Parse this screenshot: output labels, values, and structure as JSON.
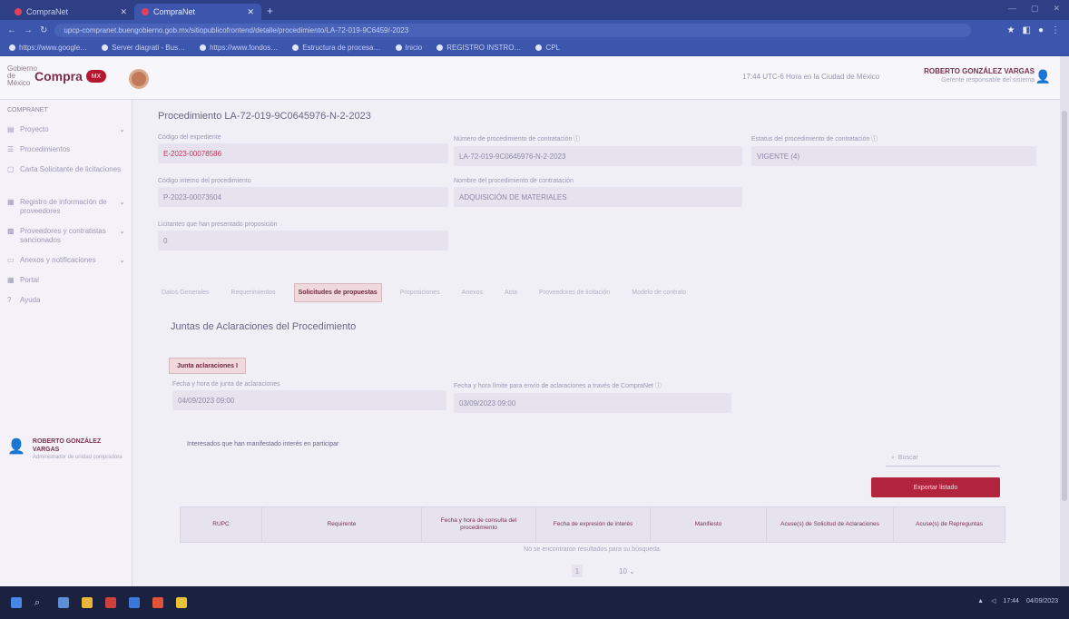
{
  "browser": {
    "tabs": [
      "CompraNet",
      "CompraNet"
    ],
    "url": "upcp-compranet.buengobierno.gob.mx/sitiopublicofrontend/detalle/procedimiento/LA-72-019-9C6459/-2023",
    "bookmarks": [
      "https://www.google…",
      "Server diagrati - Bus…",
      "https://www.fondos…",
      "Estructura de procesa…",
      "Inicio",
      "REGISTRO INSTRO…",
      "CPL"
    ]
  },
  "header": {
    "logo_gob": "Gobierno de México",
    "logo_name": "Compra",
    "logo_badge": "MX",
    "message": "17:44 UTC-6 Hora en la Ciudad de México",
    "user_name": "ROBERTO GONZÁLEZ VARGAS",
    "user_role": "Gerente responsable del sistema"
  },
  "sidebar": {
    "title": "COMPRANET",
    "items": [
      "Proyecto",
      "Procedimientos",
      "Carta Solicitante de licitaciones",
      "Registro de información de proveedores",
      "Proveedores y contratistas sancionados",
      "Anexos y notificaciones",
      "Portal",
      "Ayuda"
    ],
    "user_name": "ROBERTO GONZÁLEZ VARGAS",
    "user_role": "Administrador de unidad compradora"
  },
  "procedure": {
    "title": "Procedimiento LA-72-019-9C0645976-N-2-2023",
    "fields": {
      "expediente_label": "Código del expediente",
      "expediente_value": "E-2023-00078586",
      "numero_label": "Número de procedimiento de contratación ⓘ",
      "numero_value": "LA-72-019-9C0645976-N-2-2023",
      "estatus_label": "Estatus del procedimiento de contratación ⓘ",
      "estatus_value": "VIGENTE (4)",
      "codigo_label": "Código interno del procedimiento",
      "codigo_value": "P-2023-00073504",
      "nombre_label": "Nombre del procedimiento de contratación",
      "nombre_value": "ADQUISICIÓN DE MATERIALES",
      "licitantes_label": "Licitantes que han presentado proposición",
      "licitantes_value": "0"
    }
  },
  "tabs": [
    "Datos Generales",
    "Requerimientos",
    "Solicitudes de propuestas",
    "Proposiciones",
    "Anexos",
    "Acta",
    "Proveedores de licitación",
    "Modelo de contrato"
  ],
  "section": {
    "title": "Juntas de Aclaraciones del Procedimiento",
    "junta_button": "Junta aclaraciones I",
    "fecha_label": "Fecha y hora de junta de aclaraciones",
    "fecha_value": "04/09/2023 09:00",
    "limite_label": "Fecha y hora límite para envío de aclaraciones a través de CompraNet ⓘ",
    "limite_value": "03/09/2023 09:00",
    "note": "Interesados que han manifestado interés en participar",
    "search_placeholder": "Buscar",
    "export_button": "Exportar listado",
    "columns": [
      "RUPC",
      "Requirente",
      "Fecha y hora de consulta del procedimiento",
      "Fecha de expresión de interés",
      "Manifiesto",
      "Acuse(s) de Solicitud de Aclaraciones",
      "Acuse(s) de Repreguntas"
    ],
    "empty_text": "No se encontraron resultados para su búsqueda.",
    "page": "1",
    "page_size": "10"
  },
  "taskbar": {
    "time": "17:44",
    "date": "04/09/2023"
  }
}
